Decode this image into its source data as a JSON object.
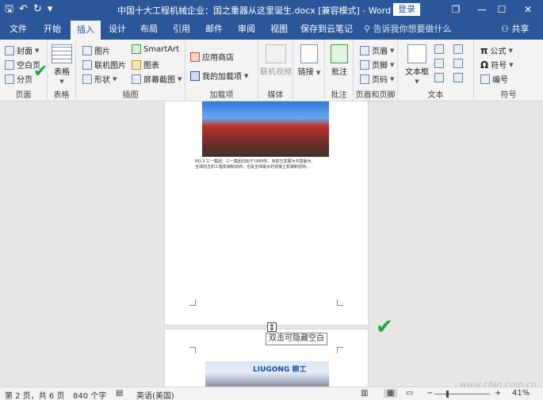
{
  "window": {
    "title": "中国十大工程机械企业：国之重器从这里诞生.docx [兼容模式] - Word",
    "login_label": "登录",
    "controls": {
      "restore": "❐",
      "minimize": "—",
      "maximize": "☐",
      "close": "✕"
    },
    "quick_access": {
      "save": "🖫",
      "undo": "↶",
      "redo": "↻",
      "customize": "▾"
    }
  },
  "tabs": [
    {
      "label": "文件"
    },
    {
      "label": "开始"
    },
    {
      "label": "插入",
      "active": true
    },
    {
      "label": "设计"
    },
    {
      "label": "布局"
    },
    {
      "label": "引用"
    },
    {
      "label": "邮件"
    },
    {
      "label": "审阅"
    },
    {
      "label": "视图"
    },
    {
      "label": "保存到云笔记"
    }
  ],
  "search": {
    "placeholder": "告诉我你想要做什么"
  },
  "share": {
    "label": "共享"
  },
  "ribbon": {
    "pages": {
      "cover": "封面",
      "blank": "空白页",
      "break": "分页",
      "group": "页面"
    },
    "table": {
      "label": "表格",
      "group": "表格"
    },
    "illustrations": {
      "picture": "图片",
      "online_picture": "联机图片",
      "shapes": "形状",
      "smartart": "SmartArt",
      "chart": "图表",
      "screenshot": "屏幕截图",
      "group": "插图"
    },
    "addins": {
      "store": "应用商店",
      "my_addins": "我的加载项",
      "group": "加载项"
    },
    "media": {
      "online_video": "联机视频",
      "group": "媒体"
    },
    "links": {
      "link": "链接"
    },
    "comments": {
      "comment": "批注",
      "group": "批注"
    },
    "header_footer": {
      "header": "页眉",
      "footer": "页脚",
      "page_number": "页码",
      "group": "页眉和页脚"
    },
    "text": {
      "textbox": "文本框",
      "group": "文本"
    },
    "symbols": {
      "equation": "公式",
      "symbol": "符号",
      "number": "编号",
      "group": "符号"
    }
  },
  "document": {
    "caption_line1": "NO.3  三一集团：三一集团创始于1989年，目前已发展为中国最大、",
    "caption_line2": "全球前五的工程机械制造商，也是全球最大的混凝土机械制造商。",
    "tooltip": "双击可隐藏空白",
    "brand_sign": "LIUGONG 柳工"
  },
  "status": {
    "page": "第 2 页，共 6 页",
    "words": "840 个字",
    "language": "英语(美国)",
    "zoom": "41%",
    "zoom_minus": "−",
    "zoom_plus": "+"
  },
  "watermark": "www.cfan.com.cn"
}
